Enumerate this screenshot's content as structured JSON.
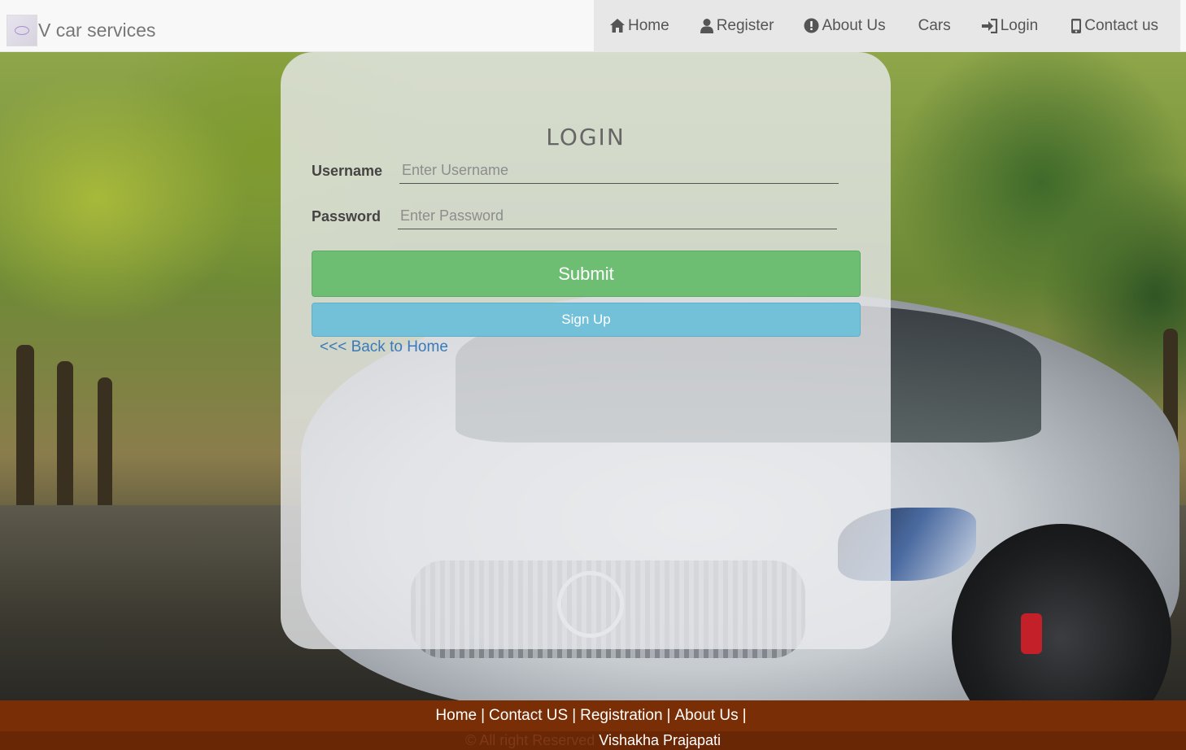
{
  "brand": {
    "name": "V car services",
    "logo_icon": "brand-logo-icon"
  },
  "nav": {
    "items": [
      {
        "label": "Home",
        "icon": "home-icon"
      },
      {
        "label": "Register",
        "icon": "user-icon"
      },
      {
        "label": "About Us",
        "icon": "info-icon"
      },
      {
        "label": "Cars",
        "icon": ""
      },
      {
        "label": "Login",
        "icon": "login-icon"
      },
      {
        "label": "Contact us",
        "icon": "phone-icon"
      }
    ]
  },
  "login": {
    "title": "LOGIN",
    "username_label": "Username",
    "username_placeholder": "Enter Username",
    "username_value": "",
    "password_label": "Password",
    "password_placeholder": "Enter Password",
    "password_value": "",
    "submit_label": "Submit",
    "signup_label": "Sign Up",
    "back_link": "<<< Back to Home"
  },
  "footer": {
    "links": [
      "Home",
      "Contact US",
      "Registration",
      "About Us"
    ],
    "separator": "|",
    "copyright": "© All right Reserved",
    "author": "Vishakha Prajapati"
  },
  "colors": {
    "nav_bg": "#f8f8f8",
    "menu_bg": "#e7e7e7",
    "submit": "#6dbe72",
    "signup": "#73c1d9",
    "link": "#3a7ab8",
    "footer": "#7a2e06"
  }
}
